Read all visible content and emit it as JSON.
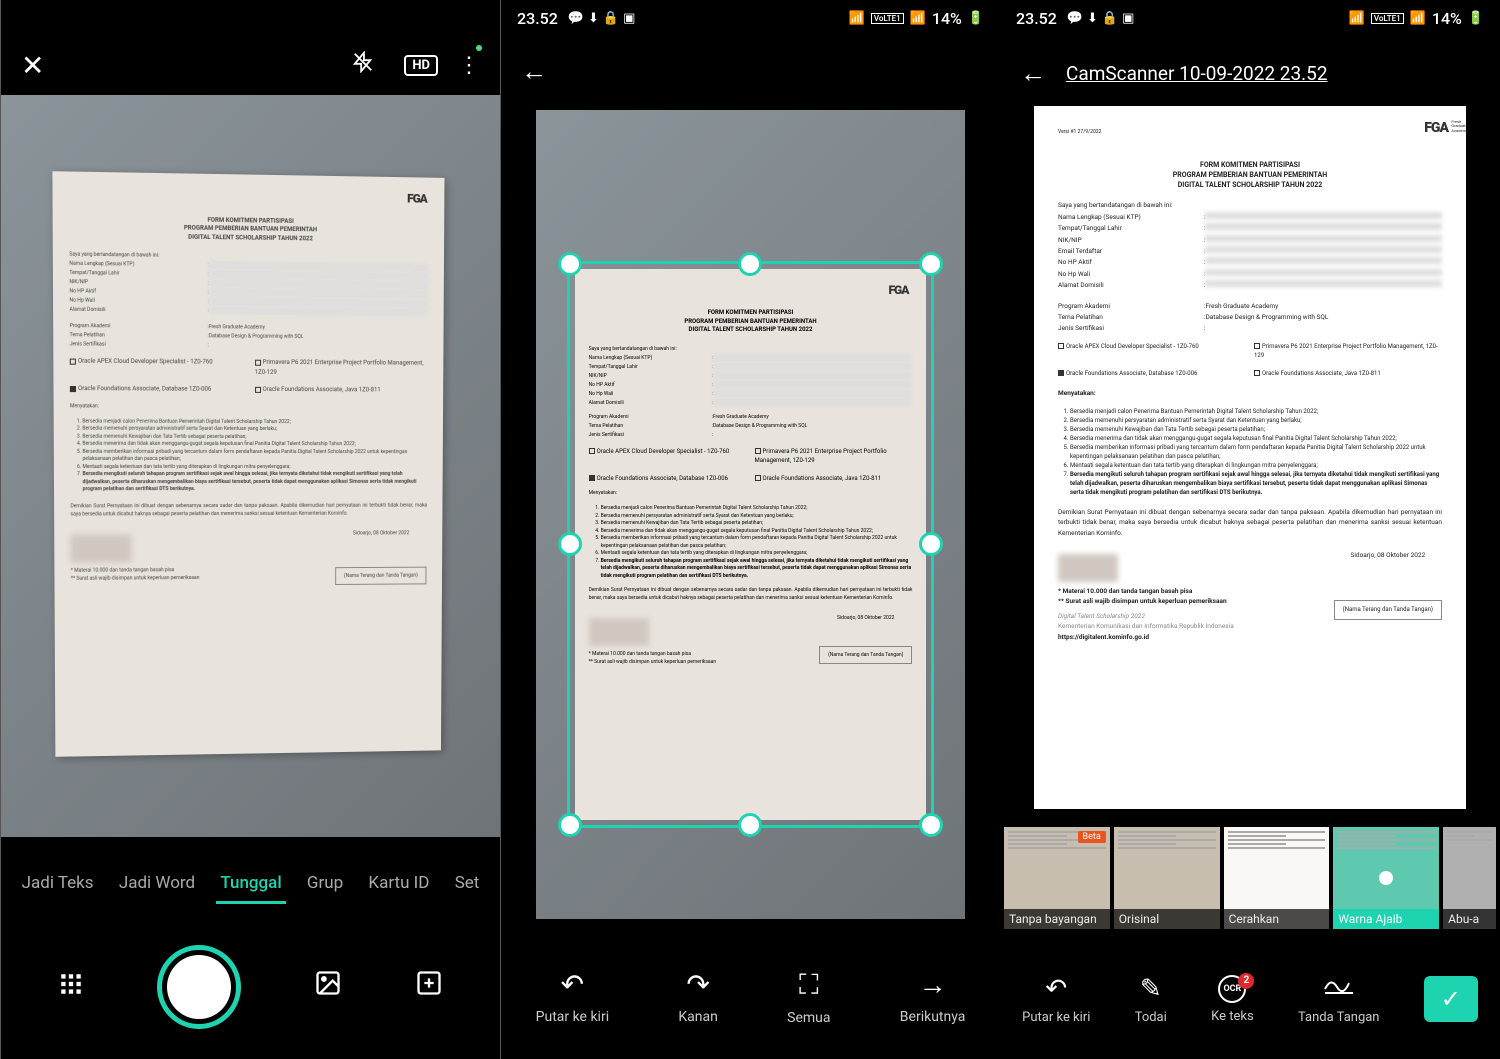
{
  "status": {
    "time": "23.52",
    "battery": "14%",
    "network_badge": "VoLTE1"
  },
  "panel3": {
    "title": "CamScanner 10-09-2022 23.52"
  },
  "doc": {
    "versi": "Versi #1 27/9/2022",
    "logo": "FGA",
    "logo_sub": "Fresh\nGraduate\nAcademy",
    "header1": "FORM KOMITMEN PARTISIPASI",
    "header2": "PROGRAM PEMBERIAN BANTUAN PEMERINTAH",
    "header3": "DIGITAL TALENT SCHOLARSHIP TAHUN 2022",
    "intro": "Saya yang bertandatangan di bawah ini:",
    "fields": {
      "nama": "Nama Lengkap (Sesuai KTP)",
      "ttl": "Tempat/Tanggal Lahir",
      "nik": "NIK/NIP",
      "email": "Email Terdaftar",
      "hp": "No HP Aktif",
      "wali": "No Hp Wali",
      "alamat": "Alamat Domisili",
      "program": "Program Akademi",
      "program_v": "Fresh Graduate Academy",
      "tema": "Tema Pelatihan",
      "tema_v": "Database Design & Programming with SQL",
      "jenis": "Jenis Sertifikasi"
    },
    "cert": {
      "apex": "Oracle APEX Cloud Developer Specialist - 1Z0-760",
      "primavera": "Primavera P6 2021 Enterprise Project Portfolio Management, 1Z0-129",
      "foundations_db": "Oracle Foundations Associate, Database 1Z0-006",
      "foundations_java": "Oracle Foundations Associate, Java 1Z0-811"
    },
    "menyatakan": "Menyatakan:",
    "list": [
      "Bersedia menjadi calon Penerima Bantuan Pemerintah Digital Talent Scholarship Tahun 2022;",
      "Bersedia memenuhi persyaratan administratif serta Syarat dan Ketentuan yang berlaku;",
      "Bersedia memenuhi Kewajiban dan Tata Tertib sebagai peserta pelatihan;",
      "Bersedia menerima dan tidak akan menggangu-gugat segala keputusan final Panitia Digital Talent Scholarship Tahun 2022;",
      "Bersedia memberikan informasi pribadi yang tercantum dalam form pendaftaran kepada Panitia Digital Talent Scholarship 2022 untuk kepentingan pelaksanaan pelatihan dan pasca pelatihan;",
      "Mentaati segala ketentuan dan tata tertib yang diterapkan di lingkungan mitra penyelenggara;",
      "Bersedia mengikuti seluruh tahapan program sertifikasi sejak awal hingga selesai, jika ternyata diketahui tidak mengikuti sertifikasi yang telah dijadwalkan, peserta diharuskan mengembalikan biaya sertifikasi tersebut, peserta tidak dapat menggunakan aplikasi Simonas serta tidak mengikuti program pelatihan dan sertifikasi DTS berikutnya."
    ],
    "closing1": "Demikian Surat Pernyataan ini dibuat dengan sebenarnya secara sadar dan tanpa paksaan. Apabila dikemudian hari pernyataan ini terbukti tidak benar, maka saya bersedia untuk dicabut haknya sebagai peserta pelatihan dan menerima sanksi sesuai ketentuan Kementerian Kominfo.",
    "date": "Sidoarjo, 08 Oktober 2022",
    "sig": "(Nama Terang dan Tanda Tangan)",
    "footnote1": "* Materai 10.000 dan tanda tangan basah pisa",
    "footnote2": "** Surat asli wajib disimpan untuk keperluan pemeriksaan",
    "footer1": "Digital Talent Scholarship 2022",
    "footer2": "Kementerian Komunikasi dan Informatika Republik Indonesia",
    "footer3": "https://digitalent.kominfo.go.id"
  },
  "modes": {
    "teks": "Jadi Teks",
    "word": "Jadi Word",
    "tunggal": "Tunggal",
    "grup": "Grup",
    "kartu": "Kartu ID",
    "set": "Set"
  },
  "crop_actions": {
    "putar_kiri": "Putar ke kiri",
    "kanan": "Kanan",
    "semua": "Semua",
    "berikutnya": "Berikutnya"
  },
  "filters": {
    "tanpa": "Tanpa bayangan",
    "orisinal": "Orisinal",
    "cerahkan": "Cerahkan",
    "warna": "Warna Ajaib",
    "abu": "Abu-a",
    "beta": "Beta"
  },
  "edit_actions": {
    "putar_kiri": "Putar ke kiri",
    "todai": "Todai",
    "ke_teks": "Ke teks",
    "tanda": "Tanda Tangan"
  },
  "ocr_count": "2"
}
